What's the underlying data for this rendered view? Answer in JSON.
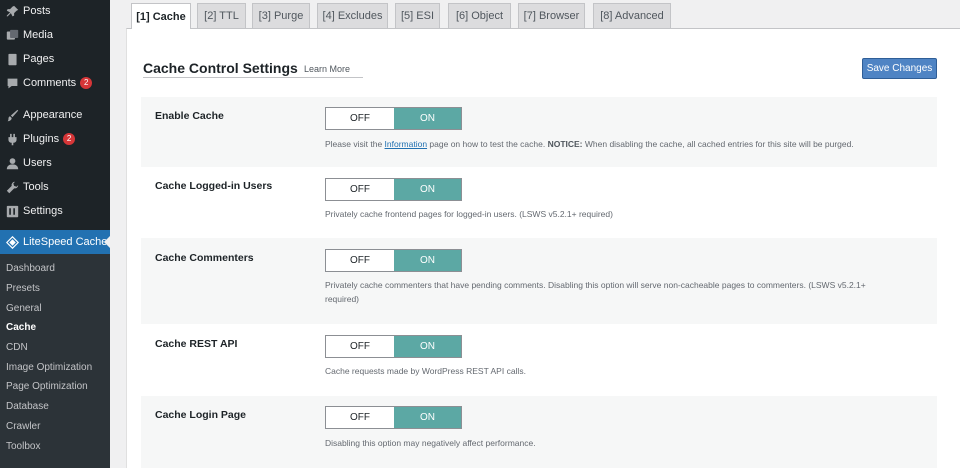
{
  "sidebar": {
    "top_items": [
      {
        "label": "Posts",
        "icon": "pin-icon"
      },
      {
        "label": "Media",
        "icon": "media-icon"
      },
      {
        "label": "Pages",
        "icon": "page-icon"
      },
      {
        "label": "Comments",
        "icon": "comment-icon",
        "badge": "2"
      },
      {
        "label": "Appearance",
        "icon": "brush-icon"
      },
      {
        "label": "Plugins",
        "icon": "plugin-icon",
        "badge": "2"
      },
      {
        "label": "Users",
        "icon": "user-icon"
      },
      {
        "label": "Tools",
        "icon": "wrench-icon"
      },
      {
        "label": "Settings",
        "icon": "settings-icon"
      }
    ],
    "current": {
      "label": "LiteSpeed Cache",
      "icon": "diamond-icon"
    },
    "sub_items": [
      "Dashboard",
      "Presets",
      "General",
      "Cache",
      "CDN",
      "Image Optimization",
      "Page Optimization",
      "Database",
      "Crawler",
      "Toolbox"
    ],
    "active_sub": "Cache"
  },
  "tabs": [
    "[1] Cache",
    "[2] TTL",
    "[3] Purge",
    "[4] Excludes",
    "[5] ESI",
    "[6] Object",
    "[7] Browser",
    "[8] Advanced"
  ],
  "active_tab": "[1] Cache",
  "section": {
    "title": "Cache Control Settings",
    "learn_more": "Learn More",
    "save_label": "Save Changes"
  },
  "toggle_labels": {
    "off": "OFF",
    "on": "ON"
  },
  "settings": [
    {
      "label": "Enable Cache",
      "state": "ON",
      "desc_pre": "Please visit the ",
      "desc_link": "Information",
      "desc_mid": " page on how to test the cache. ",
      "desc_notice": "NOTICE:",
      "desc_post": " When disabling the cache, all cached entries for this site will be purged."
    },
    {
      "label": "Cache Logged-in Users",
      "state": "ON",
      "desc": "Privately cache frontend pages for logged-in users. (LSWS v5.2.1+ required)"
    },
    {
      "label": "Cache Commenters",
      "state": "ON",
      "desc_line1": "Privately cache commenters that have pending comments. Disabling this option will serve non-cacheable pages to commenters. (LSWS v5.2.1+",
      "desc_line2": "required)"
    },
    {
      "label": "Cache REST API",
      "state": "ON",
      "desc": "Cache requests made by WordPress REST API calls."
    },
    {
      "label": "Cache Login Page",
      "state": "ON",
      "desc": "Disabling this option may negatively affect performance."
    }
  ],
  "colors": {
    "sidebar_bg": "#1d2327",
    "accent": "#2271b1",
    "toggle_on": "#5ca8a4",
    "save_button": "#4f84c4",
    "badge": "#d63638"
  }
}
